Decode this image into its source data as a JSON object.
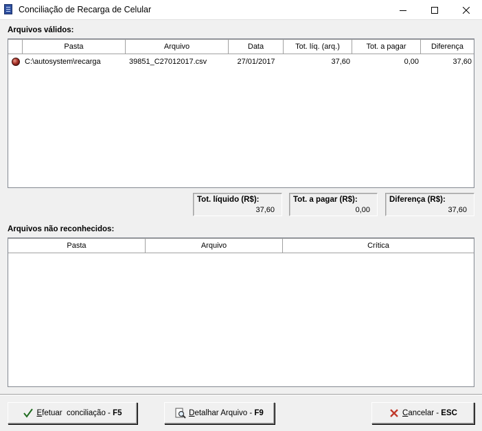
{
  "window": {
    "title": "Conciliação de Recarga de Celular",
    "app_icon": "app-document-icon"
  },
  "valid_files": {
    "section_label": "Arquivos válidos:",
    "columns": [
      "Pasta",
      "Arquivo",
      "Data",
      "Tot. líq. (arq.)",
      "Tot. a pagar",
      "Diferença"
    ],
    "rows": [
      {
        "status_icon": "red-ball-icon",
        "pasta": "C:\\autosystem\\recarga",
        "arquivo": "39851_C27012017.csv",
        "data": "27/01/2017",
        "tot_liq": "37,60",
        "tot_pagar": "0,00",
        "diferenca": "37,60"
      }
    ]
  },
  "totals": {
    "tot_liquido_label": "Tot. líquido (R$):",
    "tot_liquido_value": "37,60",
    "tot_pagar_label": "Tot. a pagar (R$):",
    "tot_pagar_value": "0,00",
    "diferenca_label": "Diferença (R$):",
    "diferenca_value": "37,60"
  },
  "unrecognized_files": {
    "section_label": "Arquivos não reconhecidos:",
    "columns": [
      "Pasta",
      "Arquivo",
      "Crítica"
    ],
    "rows": []
  },
  "buttons": {
    "efetuar": {
      "mnemonic": "E",
      "rest": "fetuar  conciliação - ",
      "key": "F5",
      "icon": "checkmark-icon"
    },
    "detalhar": {
      "mnemonic": "D",
      "rest": "etalhar Arquivo - ",
      "key": "F9",
      "icon": "magnifier-document-icon"
    },
    "cancelar": {
      "mnemonic": "C",
      "rest": "ancelar - ",
      "key": "ESC",
      "icon": "red-x-icon"
    }
  },
  "colors": {
    "title_bg": "#ffffff",
    "window_bg": "#f0f0f0",
    "grid_bg": "#ffffff",
    "cancel_x": "#c0392b",
    "check_green": "#2f8a2f"
  }
}
